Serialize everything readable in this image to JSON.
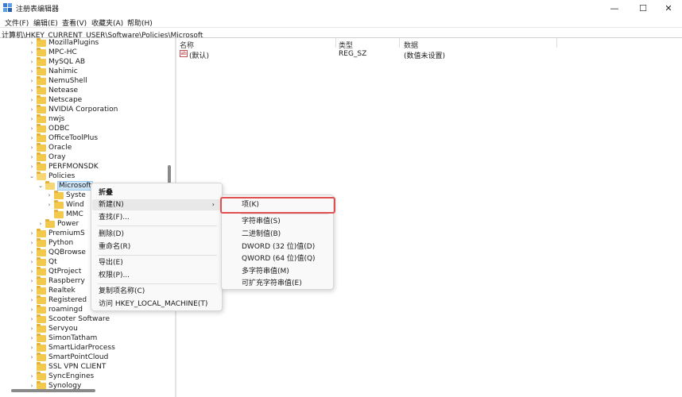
{
  "window": {
    "title": "注册表编辑器",
    "minimize_glyph": "—",
    "maximize_glyph": "☐",
    "close_glyph": "✕"
  },
  "menubar": {
    "items": [
      "文件(F)",
      "编辑(E)",
      "查看(V)",
      "收藏夹(A)",
      "帮助(H)"
    ]
  },
  "address": {
    "path": "计算机\\HKEY_CURRENT_USER\\Software\\Policies\\Microsoft"
  },
  "tree": {
    "expanded_glyph": "⌄",
    "collapsed_glyph": "›",
    "items": [
      {
        "label": "MozillaPlugins",
        "state": "collapsed"
      },
      {
        "label": "MPC-HC",
        "state": "collapsed"
      },
      {
        "label": "MySQL AB",
        "state": "collapsed"
      },
      {
        "label": "Nahimic",
        "state": "collapsed"
      },
      {
        "label": "NemuShell",
        "state": "collapsed"
      },
      {
        "label": "Netease",
        "state": "collapsed"
      },
      {
        "label": "Netscape",
        "state": "collapsed"
      },
      {
        "label": "NVIDIA Corporation",
        "state": "collapsed"
      },
      {
        "label": "nwjs",
        "state": "collapsed"
      },
      {
        "label": "ODBC",
        "state": "collapsed"
      },
      {
        "label": "OfficeToolPlus",
        "state": "collapsed"
      },
      {
        "label": "Oracle",
        "state": "collapsed"
      },
      {
        "label": "Oray",
        "state": "collapsed"
      },
      {
        "label": "PERFMONSDK",
        "state": "collapsed"
      },
      {
        "label": "Policies",
        "state": "expanded"
      },
      {
        "label": "Microsoft",
        "state": "expanded",
        "selected": true
      },
      {
        "label": "Syste",
        "state": "collapsed"
      },
      {
        "label": "Wind",
        "state": "collapsed"
      },
      {
        "label": "MMC",
        "state": "leaf"
      },
      {
        "label": "Power",
        "state": "collapsed"
      },
      {
        "label": "PremiumS",
        "state": "collapsed"
      },
      {
        "label": "Python",
        "state": "collapsed"
      },
      {
        "label": "QQBrowse",
        "state": "collapsed"
      },
      {
        "label": "Qt",
        "state": "collapsed"
      },
      {
        "label": "QtProject",
        "state": "collapsed"
      },
      {
        "label": "Raspberry",
        "state": "collapsed"
      },
      {
        "label": "Realtek",
        "state": "collapsed"
      },
      {
        "label": "Registered",
        "state": "collapsed"
      },
      {
        "label": "roamingd",
        "state": "collapsed"
      },
      {
        "label": "Scooter Software",
        "state": "collapsed"
      },
      {
        "label": "Servyou",
        "state": "collapsed"
      },
      {
        "label": "SimonTatham",
        "state": "collapsed"
      },
      {
        "label": "SmartLidarProcess",
        "state": "collapsed"
      },
      {
        "label": "SmartPointCloud",
        "state": "collapsed"
      },
      {
        "label": "SSL VPN CLIENT",
        "state": "collapsed"
      },
      {
        "label": "SyncEngines",
        "state": "collapsed"
      },
      {
        "label": "Synology",
        "state": "collapsed"
      }
    ]
  },
  "list": {
    "columns": [
      "名称",
      "类型",
      "数据"
    ],
    "rows": [
      {
        "name": "(默认)",
        "type": "REG_SZ",
        "data": "(数值未设置)",
        "icon": "ab"
      }
    ]
  },
  "context_menu": {
    "collapse": "折叠",
    "new": "新建(N)",
    "new_arrow": "›",
    "find": "查找(F)...",
    "delete": "删除(D)",
    "rename": "重命名(R)",
    "export": "导出(E)",
    "permissions": "权限(P)...",
    "copy_key_name": "复制项名称(C)",
    "visit_hklm": "访问 HKEY_LOCAL_MACHINE(T)"
  },
  "submenu": {
    "key": "项(K)",
    "string_value": "字符串值(S)",
    "binary_value": "二进制值(B)",
    "dword_value": "DWORD (32 位)值(D)",
    "qword_value": "QWORD (64 位)值(Q)",
    "multi_string_value": "多字符串值(M)",
    "expandable_string_value": "可扩充字符串值(E)"
  },
  "colors": {
    "highlight_border": "#e05050",
    "selection": "#cce4f7",
    "folder": "#f2c94c"
  }
}
